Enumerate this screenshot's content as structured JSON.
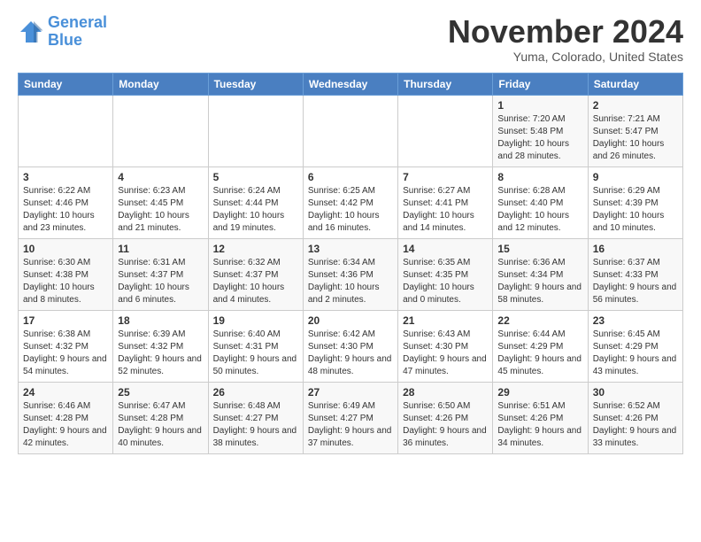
{
  "logo": {
    "line1": "General",
    "line2": "Blue"
  },
  "title": "November 2024",
  "subtitle": "Yuma, Colorado, United States",
  "days_header": [
    "Sunday",
    "Monday",
    "Tuesday",
    "Wednesday",
    "Thursday",
    "Friday",
    "Saturday"
  ],
  "weeks": [
    [
      {
        "day": "",
        "info": ""
      },
      {
        "day": "",
        "info": ""
      },
      {
        "day": "",
        "info": ""
      },
      {
        "day": "",
        "info": ""
      },
      {
        "day": "",
        "info": ""
      },
      {
        "day": "1",
        "info": "Sunrise: 7:20 AM\nSunset: 5:48 PM\nDaylight: 10 hours and 28 minutes."
      },
      {
        "day": "2",
        "info": "Sunrise: 7:21 AM\nSunset: 5:47 PM\nDaylight: 10 hours and 26 minutes."
      }
    ],
    [
      {
        "day": "3",
        "info": "Sunrise: 6:22 AM\nSunset: 4:46 PM\nDaylight: 10 hours and 23 minutes."
      },
      {
        "day": "4",
        "info": "Sunrise: 6:23 AM\nSunset: 4:45 PM\nDaylight: 10 hours and 21 minutes."
      },
      {
        "day": "5",
        "info": "Sunrise: 6:24 AM\nSunset: 4:44 PM\nDaylight: 10 hours and 19 minutes."
      },
      {
        "day": "6",
        "info": "Sunrise: 6:25 AM\nSunset: 4:42 PM\nDaylight: 10 hours and 16 minutes."
      },
      {
        "day": "7",
        "info": "Sunrise: 6:27 AM\nSunset: 4:41 PM\nDaylight: 10 hours and 14 minutes."
      },
      {
        "day": "8",
        "info": "Sunrise: 6:28 AM\nSunset: 4:40 PM\nDaylight: 10 hours and 12 minutes."
      },
      {
        "day": "9",
        "info": "Sunrise: 6:29 AM\nSunset: 4:39 PM\nDaylight: 10 hours and 10 minutes."
      }
    ],
    [
      {
        "day": "10",
        "info": "Sunrise: 6:30 AM\nSunset: 4:38 PM\nDaylight: 10 hours and 8 minutes."
      },
      {
        "day": "11",
        "info": "Sunrise: 6:31 AM\nSunset: 4:37 PM\nDaylight: 10 hours and 6 minutes."
      },
      {
        "day": "12",
        "info": "Sunrise: 6:32 AM\nSunset: 4:37 PM\nDaylight: 10 hours and 4 minutes."
      },
      {
        "day": "13",
        "info": "Sunrise: 6:34 AM\nSunset: 4:36 PM\nDaylight: 10 hours and 2 minutes."
      },
      {
        "day": "14",
        "info": "Sunrise: 6:35 AM\nSunset: 4:35 PM\nDaylight: 10 hours and 0 minutes."
      },
      {
        "day": "15",
        "info": "Sunrise: 6:36 AM\nSunset: 4:34 PM\nDaylight: 9 hours and 58 minutes."
      },
      {
        "day": "16",
        "info": "Sunrise: 6:37 AM\nSunset: 4:33 PM\nDaylight: 9 hours and 56 minutes."
      }
    ],
    [
      {
        "day": "17",
        "info": "Sunrise: 6:38 AM\nSunset: 4:32 PM\nDaylight: 9 hours and 54 minutes."
      },
      {
        "day": "18",
        "info": "Sunrise: 6:39 AM\nSunset: 4:32 PM\nDaylight: 9 hours and 52 minutes."
      },
      {
        "day": "19",
        "info": "Sunrise: 6:40 AM\nSunset: 4:31 PM\nDaylight: 9 hours and 50 minutes."
      },
      {
        "day": "20",
        "info": "Sunrise: 6:42 AM\nSunset: 4:30 PM\nDaylight: 9 hours and 48 minutes."
      },
      {
        "day": "21",
        "info": "Sunrise: 6:43 AM\nSunset: 4:30 PM\nDaylight: 9 hours and 47 minutes."
      },
      {
        "day": "22",
        "info": "Sunrise: 6:44 AM\nSunset: 4:29 PM\nDaylight: 9 hours and 45 minutes."
      },
      {
        "day": "23",
        "info": "Sunrise: 6:45 AM\nSunset: 4:29 PM\nDaylight: 9 hours and 43 minutes."
      }
    ],
    [
      {
        "day": "24",
        "info": "Sunrise: 6:46 AM\nSunset: 4:28 PM\nDaylight: 9 hours and 42 minutes."
      },
      {
        "day": "25",
        "info": "Sunrise: 6:47 AM\nSunset: 4:28 PM\nDaylight: 9 hours and 40 minutes."
      },
      {
        "day": "26",
        "info": "Sunrise: 6:48 AM\nSunset: 4:27 PM\nDaylight: 9 hours and 38 minutes."
      },
      {
        "day": "27",
        "info": "Sunrise: 6:49 AM\nSunset: 4:27 PM\nDaylight: 9 hours and 37 minutes."
      },
      {
        "day": "28",
        "info": "Sunrise: 6:50 AM\nSunset: 4:26 PM\nDaylight: 9 hours and 36 minutes."
      },
      {
        "day": "29",
        "info": "Sunrise: 6:51 AM\nSunset: 4:26 PM\nDaylight: 9 hours and 34 minutes."
      },
      {
        "day": "30",
        "info": "Sunrise: 6:52 AM\nSunset: 4:26 PM\nDaylight: 9 hours and 33 minutes."
      }
    ]
  ]
}
